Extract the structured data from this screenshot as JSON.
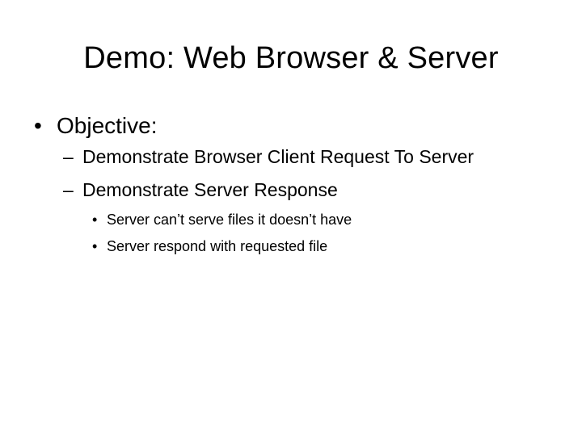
{
  "slide": {
    "title": "Demo: Web Browser & Server",
    "bullets": [
      {
        "marker": "•",
        "text": "Objective:",
        "children": [
          {
            "marker": "–",
            "text": "Demonstrate Browser Client Request To Server"
          },
          {
            "marker": "–",
            "text": "Demonstrate Server Response",
            "children": [
              {
                "marker": "•",
                "text": "Server can’t serve files it doesn’t have"
              },
              {
                "marker": "•",
                "text": "Server respond with requested file"
              }
            ]
          }
        ]
      }
    ]
  }
}
